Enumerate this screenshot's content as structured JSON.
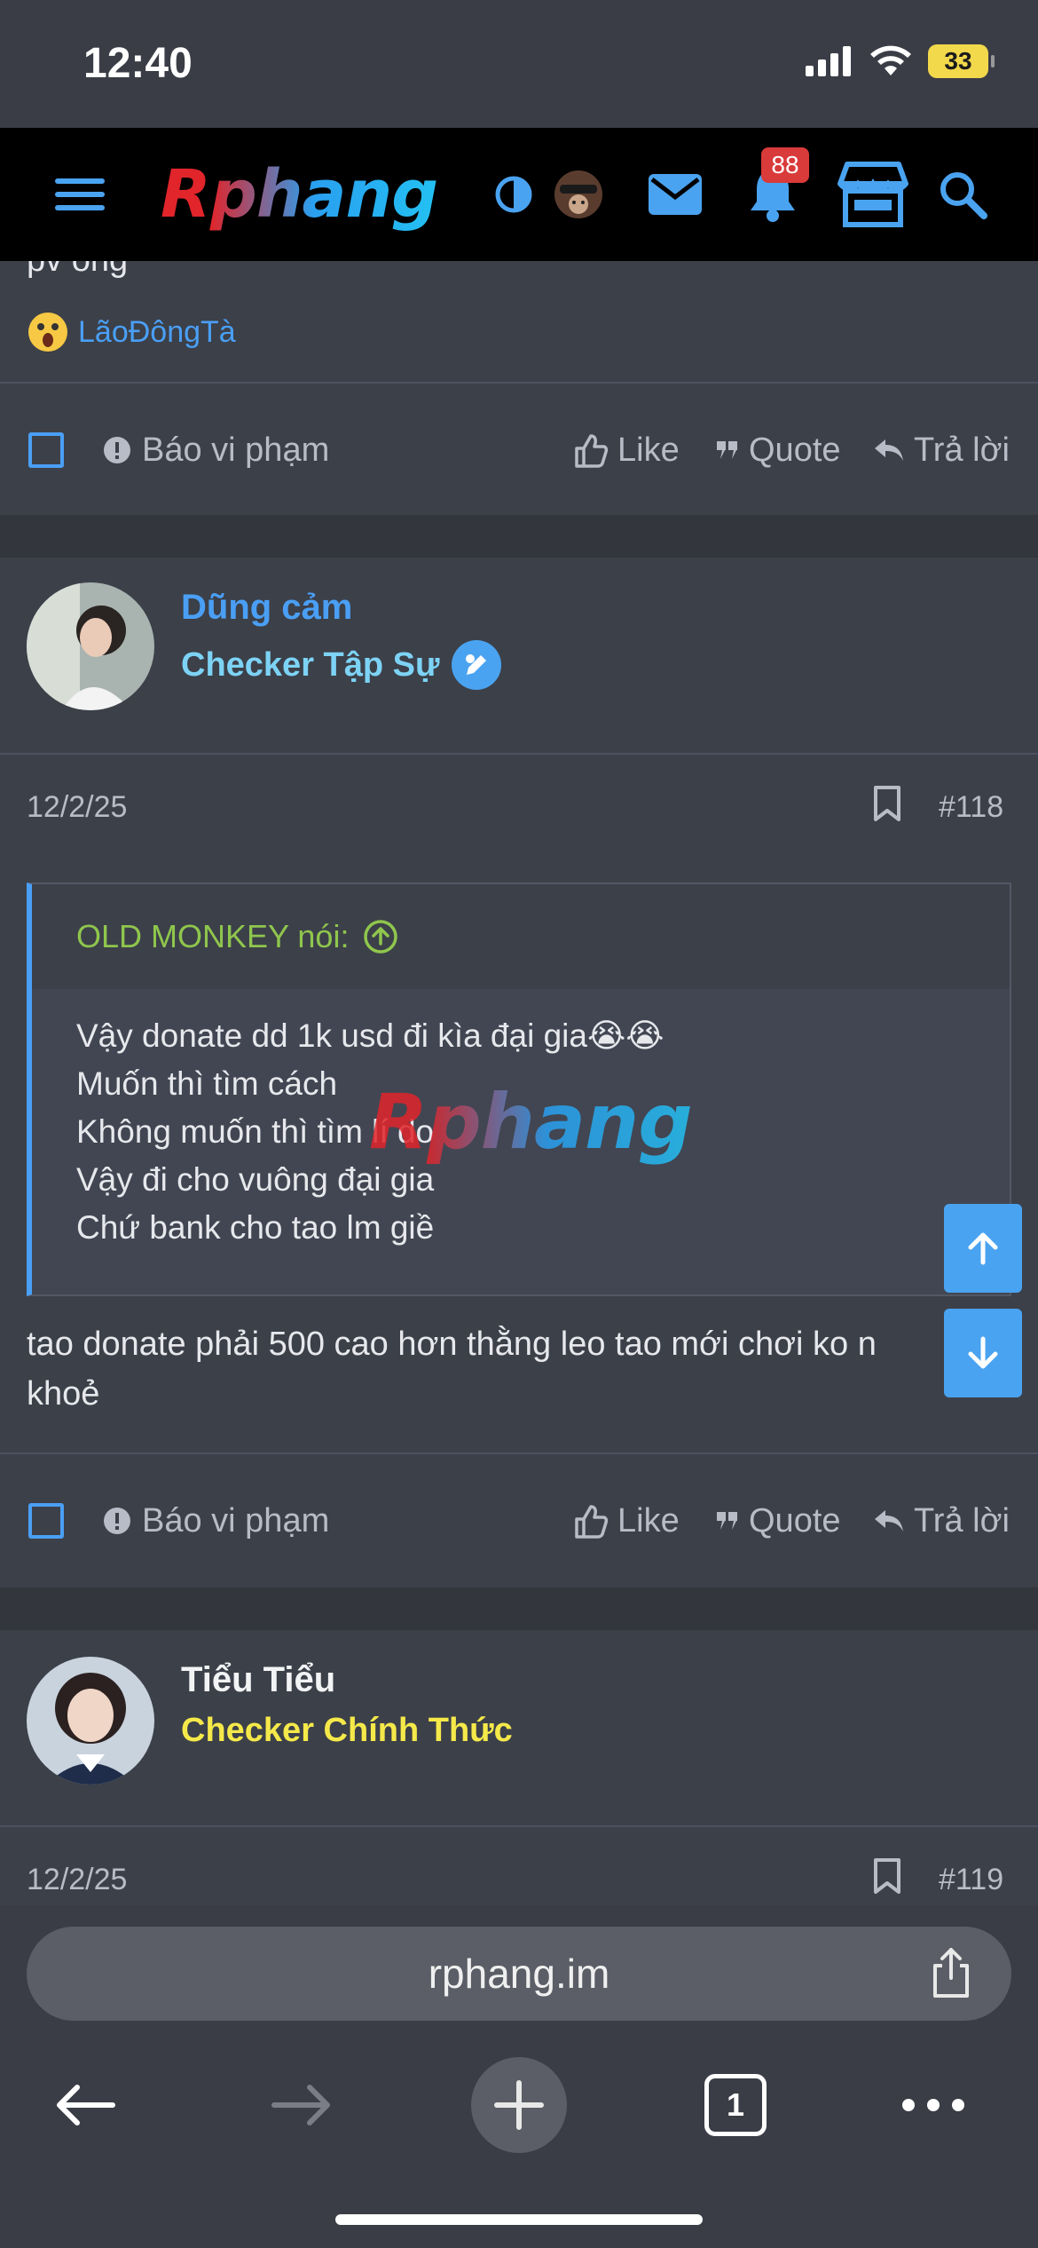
{
  "status": {
    "time": "12:40",
    "battery": "33"
  },
  "nav": {
    "logo": "Rphang",
    "notification_count": "88"
  },
  "top_post": {
    "partial_text": "pv ông",
    "reaction_user": "LãoĐôngTà",
    "actions": {
      "report": "Báo vi phạm",
      "like": "Like",
      "quote": "Quote",
      "reply": "Trả lời"
    }
  },
  "post118": {
    "username": "Dũng cảm",
    "role": "Checker Tập Sự",
    "date": "12/2/25",
    "number": "#118",
    "quote_author": "OLD MONKEY nói:",
    "quote_lines": [
      "Vậy donate dd 1k usd đi kìa đại gia😭😭",
      "Muốn thì tìm cách",
      "Không muốn thì tìm lí do",
      "Vậy đi cho vuông đại gia",
      "Chứ bank cho tao lm giề"
    ],
    "watermark": "Rphang",
    "body_line1": "tao donate phải 500 cao hơn thằng leo tao mới chơi ko n",
    "body_line2": "khoẻ",
    "actions": {
      "report": "Báo vi phạm",
      "like": "Like",
      "quote": "Quote",
      "reply": "Trả lời"
    }
  },
  "post119": {
    "username": "Tiểu Tiểu",
    "role": "Checker Chính Thức",
    "date": "12/2/25",
    "number": "#119"
  },
  "browser": {
    "url": "rphang.im",
    "tab_count": "1"
  },
  "colors": {
    "link": "#4a9ff5",
    "role_trainee": "#7dd3f5",
    "role_official": "#f5e94a",
    "quote_author": "#8fc64d"
  }
}
